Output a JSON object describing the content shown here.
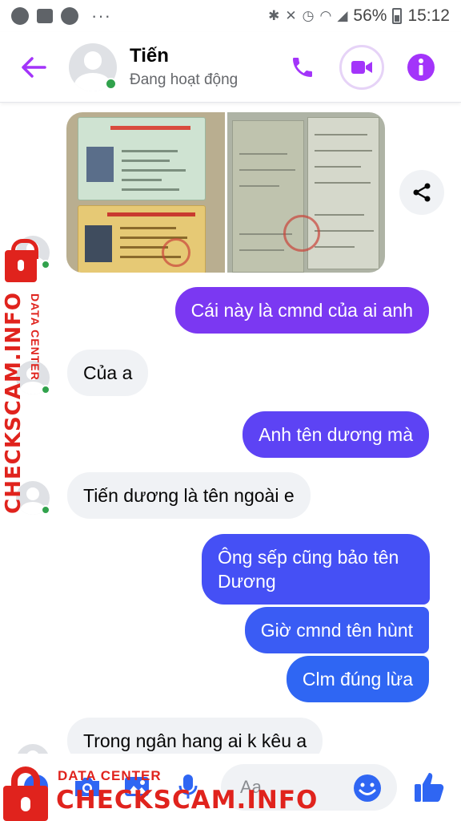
{
  "status_bar": {
    "battery": "56%",
    "time": "15:12",
    "more": "···"
  },
  "header": {
    "contact_name": "Tiến",
    "contact_status": "Đang hoạt động"
  },
  "icons": {
    "back": "arrow-left-icon",
    "call": "phone-icon",
    "video": "video-camera-icon",
    "info": "info-icon",
    "share": "share-icon",
    "camera": "camera-icon",
    "gallery": "image-icon",
    "mic": "microphone-icon",
    "emoji": "smiley-icon",
    "like": "thumbs-up-icon"
  },
  "colors": {
    "accent": "#a334fa",
    "bubble_out_top": "#7b38f2",
    "bubble_out_mid": "#5149f5",
    "bubble_out_bottom": "#2f66f3",
    "bubble_in": "#f0f2f5",
    "online": "#31a24c",
    "watermark": "#e0231d"
  },
  "messages": [
    {
      "side": "out",
      "text": "Cái này là cmnd của ai anh"
    },
    {
      "side": "in",
      "text": "Của a"
    },
    {
      "side": "out",
      "text": "Anh tên dương mà"
    },
    {
      "side": "in",
      "text": "Tiến dương là tên ngoài e"
    },
    {
      "side": "out",
      "text": "Ông sếp cũng bảo tên Dương"
    },
    {
      "side": "out",
      "text": "Giờ cmnd tên hùnt"
    },
    {
      "side": "out",
      "text": "Clm đúng lừa"
    },
    {
      "side": "in",
      "text": "Trong ngân hang ai k kêu a"
    }
  ],
  "composer": {
    "placeholder": "Aa"
  },
  "watermark": {
    "side_big": "CHECKSCAM.INFO",
    "side_small": "DATA CENTER",
    "bottom_small": "DATA CENTER",
    "bottom_big": "CHECKSCAM.INFO"
  }
}
